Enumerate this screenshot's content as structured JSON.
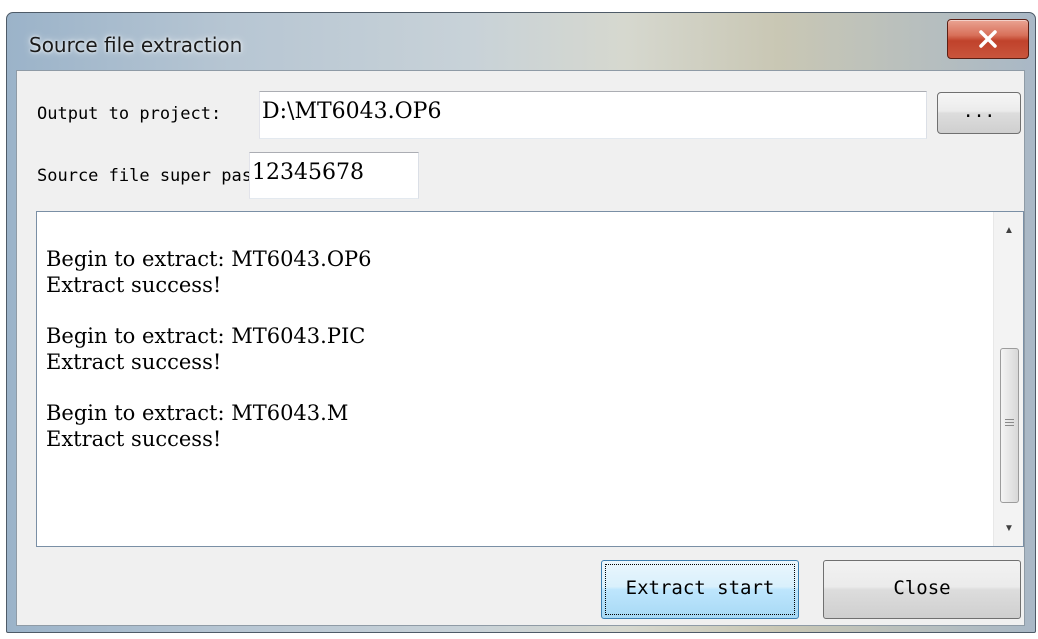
{
  "window": {
    "title": "Source file extraction",
    "close_icon": "close-icon"
  },
  "form": {
    "output_label": "Output to project:",
    "output_value": "D:\\MT6043.OP6",
    "browse_label": "...",
    "super_label": "Source file super password:",
    "super_value": "12345678"
  },
  "log": {
    "entries": [
      {
        "begin": "Begin to extract: MT6043.OP6",
        "result": "Extract success!"
      },
      {
        "begin": "Begin to extract: MT6043.PIC",
        "result": "Extract success!"
      },
      {
        "begin": "Begin to extract: MT6043.M",
        "result": "Extract success!"
      }
    ]
  },
  "buttons": {
    "extract_label": "Extract start",
    "close_label": "Close"
  },
  "colors": {
    "close_button": "#c9553c",
    "default_button": "#bee6fd"
  }
}
